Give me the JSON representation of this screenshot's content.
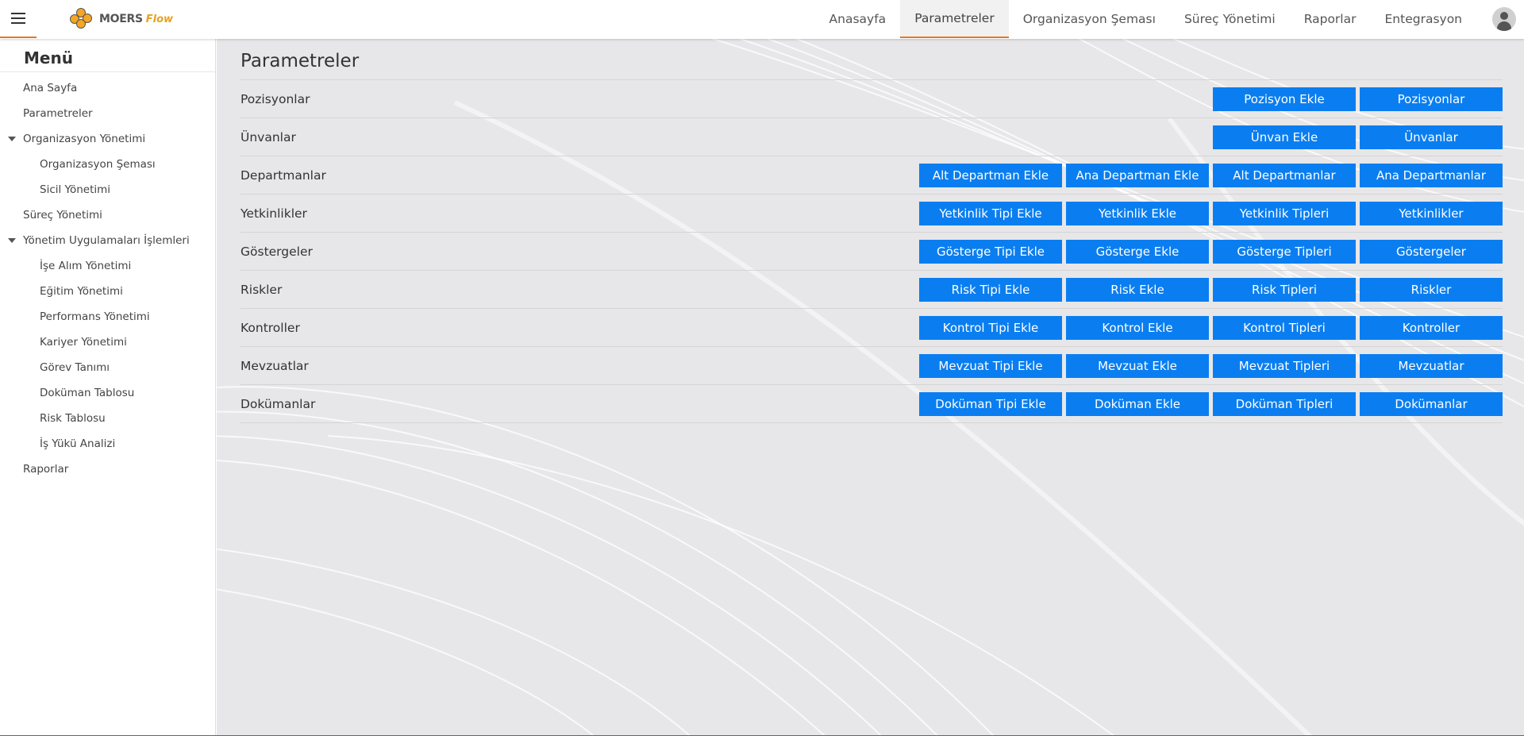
{
  "header": {
    "logo_text": "MOERS",
    "logo_flow": "Flow",
    "nav": [
      {
        "label": "Anasayfa",
        "active": false
      },
      {
        "label": "Parametreler",
        "active": true
      },
      {
        "label": "Organizasyon Şeması",
        "active": false
      },
      {
        "label": "Süreç Yönetimi",
        "active": false
      },
      {
        "label": "Raporlar",
        "active": false
      },
      {
        "label": "Entegrasyon",
        "active": false
      }
    ]
  },
  "sidebar": {
    "title": "Menü",
    "items": [
      {
        "label": "Ana Sayfa",
        "level": 1,
        "expanded": false
      },
      {
        "label": "Parametreler",
        "level": 1,
        "expanded": false
      },
      {
        "label": "Organizasyon Yönetimi",
        "level": 1,
        "expanded": true
      },
      {
        "label": "Organizasyon Şeması",
        "level": 2,
        "expanded": false
      },
      {
        "label": "Sicil Yönetimi",
        "level": 2,
        "expanded": false
      },
      {
        "label": "Süreç Yönetimi",
        "level": 1,
        "expanded": false
      },
      {
        "label": "Yönetim Uygulamaları İşlemleri",
        "level": 1,
        "expanded": true
      },
      {
        "label": "İşe Alım Yönetimi",
        "level": 2,
        "expanded": false
      },
      {
        "label": "Eğitim Yönetimi",
        "level": 2,
        "expanded": false
      },
      {
        "label": "Performans Yönetimi",
        "level": 2,
        "expanded": false
      },
      {
        "label": "Kariyer Yönetimi",
        "level": 2,
        "expanded": false
      },
      {
        "label": "Görev Tanımı",
        "level": 2,
        "expanded": false
      },
      {
        "label": "Doküman Tablosu",
        "level": 2,
        "expanded": false
      },
      {
        "label": "Risk Tablosu",
        "level": 2,
        "expanded": false
      },
      {
        "label": "İş Yükü Analizi",
        "level": 2,
        "expanded": false
      },
      {
        "label": "Raporlar",
        "level": 1,
        "expanded": false
      }
    ]
  },
  "main": {
    "title": "Parametreler",
    "rows": [
      {
        "label": "Pozisyonlar",
        "buttons": [
          "Pozisyon Ekle",
          "Pozisyonlar"
        ]
      },
      {
        "label": "Ünvanlar",
        "buttons": [
          "Ünvan Ekle",
          "Ünvanlar"
        ]
      },
      {
        "label": "Departmanlar",
        "buttons": [
          "Alt Departman Ekle",
          "Ana Departman Ekle",
          "Alt Departmanlar",
          "Ana Departmanlar"
        ]
      },
      {
        "label": "Yetkinlikler",
        "buttons": [
          "Yetkinlik Tipi Ekle",
          "Yetkinlik Ekle",
          "Yetkinlik Tipleri",
          "Yetkinlikler"
        ]
      },
      {
        "label": "Göstergeler",
        "buttons": [
          "Gösterge Tipi Ekle",
          "Gösterge Ekle",
          "Gösterge Tipleri",
          "Göstergeler"
        ]
      },
      {
        "label": "Riskler",
        "buttons": [
          "Risk Tipi Ekle",
          "Risk Ekle",
          "Risk Tipleri",
          "Riskler"
        ]
      },
      {
        "label": "Kontroller",
        "buttons": [
          "Kontrol Tipi Ekle",
          "Kontrol Ekle",
          "Kontrol Tipleri",
          "Kontroller"
        ]
      },
      {
        "label": "Mevzuatlar",
        "buttons": [
          "Mevzuat Tipi Ekle",
          "Mevzuat Ekle",
          "Mevzuat Tipleri",
          "Mevzuatlar"
        ]
      },
      {
        "label": "Dokümanlar",
        "buttons": [
          "Doküman Tipi Ekle",
          "Doküman Ekle",
          "Doküman Tipleri",
          "Dokümanlar"
        ]
      }
    ]
  },
  "colors": {
    "accent": "#e87722",
    "button": "#0a7ef0",
    "main_bg": "#e7e7e9"
  }
}
